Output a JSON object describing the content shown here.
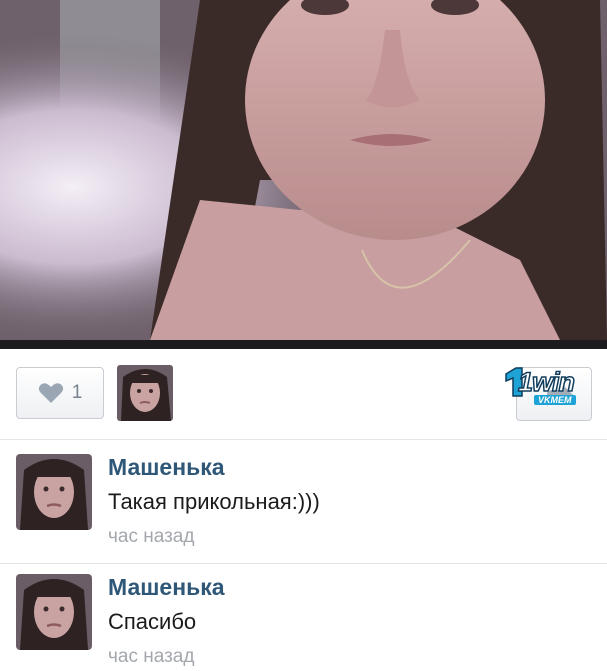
{
  "post": {
    "like_count": "1"
  },
  "watermark": {
    "brand": "1win",
    "sub": "VKMEM"
  },
  "comments": [
    {
      "author": "Машенька",
      "text": "Такая прикольная:)))",
      "time": "час назад"
    },
    {
      "author": "Машенька",
      "text": "Спасибо",
      "time": "час назад"
    }
  ],
  "icons": {
    "like": "heart-icon",
    "share": "share-icon"
  },
  "colors": {
    "author_link": "#2f5778",
    "timestamp": "#a3a7ad",
    "like_heart": "#9aa6b3"
  }
}
